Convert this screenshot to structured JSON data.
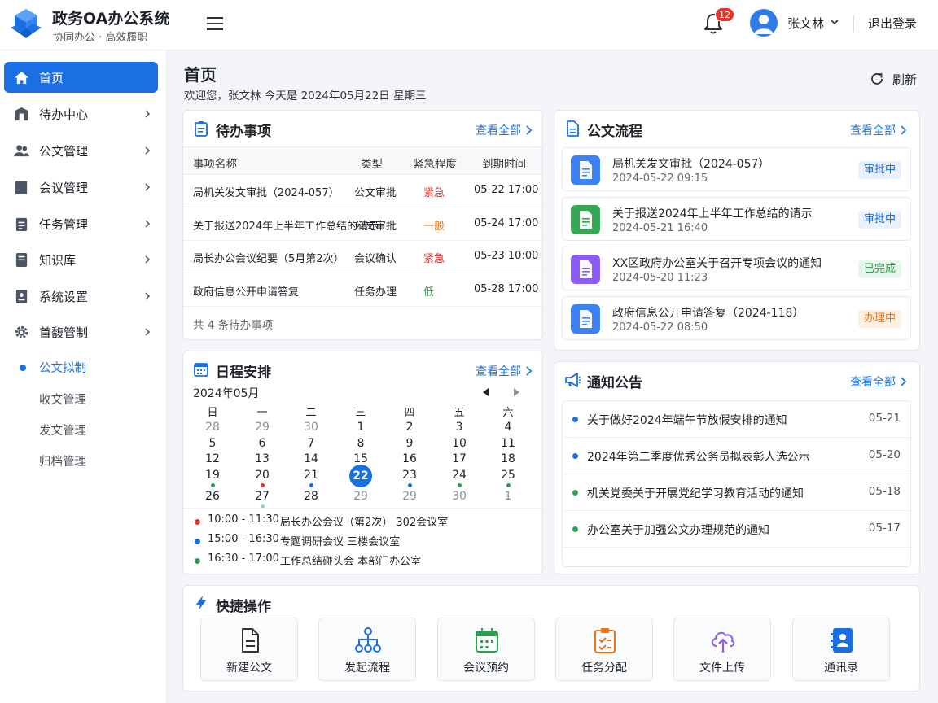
{
  "app": {
    "title": "政务OA办公系统",
    "subtitle": "协同办公 · 高效履职"
  },
  "header": {
    "notification_count": "12",
    "user_name": "张文林",
    "logout": "退出登录"
  },
  "sidebar": {
    "items": [
      {
        "label": "首页",
        "icon": "home-icon",
        "active": true
      },
      {
        "label": "待办中心",
        "icon": "inbox-icon"
      },
      {
        "label": "公文管理",
        "icon": "users-icon"
      },
      {
        "label": "会议管理",
        "icon": "meeting-icon"
      },
      {
        "label": "任务管理",
        "icon": "task-icon"
      },
      {
        "label": "知识库",
        "icon": "book-icon"
      },
      {
        "label": "系统设置",
        "icon": "settings-icon"
      },
      {
        "label": "首馥管制",
        "icon": "gear-icon"
      }
    ],
    "sub_items": [
      {
        "label": "公文拟制",
        "active": true
      },
      {
        "label": "收文管理"
      },
      {
        "label": "发文管理"
      },
      {
        "label": "归档管理"
      }
    ]
  },
  "page": {
    "title": "首页",
    "welcome": "欢迎您，张文林  今天是 2024年05月22日  星期三",
    "refresh": "刷新"
  },
  "todo": {
    "title": "待办事项",
    "more": "查看全部",
    "columns": [
      "事项名称",
      "类型",
      "紧急程度",
      "到期时间"
    ],
    "rows": [
      {
        "name": "局机关发文审批（2024-057）",
        "type": "公文审批",
        "urgency": "紧急",
        "due": "05-22 17:00",
        "urgency_color": "#e5332e"
      },
      {
        "name": "关于报送2024年上半年工作总结的请示",
        "type": "公文审批",
        "urgency": "一般",
        "due": "05-24 17:00",
        "urgency_color": "#e8741a"
      },
      {
        "name": "局长办公会议纪要（5月第2次）",
        "type": "会议确认",
        "urgency": "紧急",
        "due": "05-23 10:00",
        "urgency_color": "#e5332e"
      },
      {
        "name": "政府信息公开申请答复",
        "type": "任务办理",
        "urgency": "低",
        "due": "05-28 17:00",
        "urgency_color": "#2e9e4f"
      }
    ],
    "footer": "共 4 条待办事项"
  },
  "flow": {
    "title": "公文流程",
    "more": "查看全部",
    "items": [
      {
        "title": "局机关发文审批（2024-057）",
        "time": "2024-05-22 09:15",
        "status": "审批中",
        "icon_color": "#3b82f6",
        "status_bg": "#e8f1fd",
        "status_color": "#1a6fe3"
      },
      {
        "title": "关于报送2024年上半年工作总结的请示",
        "time": "2024-05-21 16:40",
        "status": "审批中",
        "icon_color": "#34a853",
        "status_bg": "#e8f1fd",
        "status_color": "#1a6fe3"
      },
      {
        "title": "XX区政府办公室关于召开专项会议的通知",
        "time": "2024-05-20 11:23",
        "status": "已完成",
        "icon_color": "#8b5cf6",
        "status_bg": "#e7f6ea",
        "status_color": "#2e9e4f"
      },
      {
        "title": "政府信息公开申请答复（2024-118）",
        "time": "2024-05-22 08:50",
        "status": "办理中",
        "icon_color": "#3b82f6",
        "status_bg": "#fdf0e3",
        "status_color": "#e8741a"
      }
    ]
  },
  "calendar": {
    "title": "日程安排",
    "more": "查看全部",
    "month": "2024年05月",
    "weekdays": [
      "日",
      "一",
      "二",
      "三",
      "四",
      "五",
      "六"
    ],
    "weeks": [
      [
        {
          "d": "28",
          "m": true
        },
        {
          "d": "29",
          "m": true
        },
        {
          "d": "30",
          "m": true
        },
        {
          "d": "1"
        },
        {
          "d": "2"
        },
        {
          "d": "3"
        },
        {
          "d": "4"
        }
      ],
      [
        {
          "d": "5"
        },
        {
          "d": "6"
        },
        {
          "d": "7"
        },
        {
          "d": "8"
        },
        {
          "d": "9"
        },
        {
          "d": "10"
        },
        {
          "d": "11"
        }
      ],
      [
        {
          "d": "12"
        },
        {
          "d": "13"
        },
        {
          "d": "14"
        },
        {
          "d": "15"
        },
        {
          "d": "16"
        },
        {
          "d": "17"
        },
        {
          "d": "18"
        }
      ],
      [
        {
          "d": "19",
          "dot": "#2e9e4f"
        },
        {
          "d": "20",
          "dot": "#e5332e"
        },
        {
          "d": "21",
          "dot": "#1a6fe3"
        },
        {
          "d": "22",
          "today": true
        },
        {
          "d": "23",
          "dot": "#1a6fe3"
        },
        {
          "d": "24",
          "dot": "#2e9e4f"
        },
        {
          "d": "25",
          "dot": "#2e9e4f"
        }
      ],
      [
        {
          "d": "26"
        },
        {
          "d": "27",
          "dot": "#9ad1a5"
        },
        {
          "d": "28"
        },
        {
          "d": "29",
          "m": true
        },
        {
          "d": "29",
          "m": true
        },
        {
          "d": "30",
          "m": true
        },
        {
          "d": "1",
          "m": true
        }
      ]
    ],
    "schedule": [
      {
        "time": "10:00 - 11:30",
        "desc": "局长办公会议（第2次） 302会议室",
        "color": "#e5332e"
      },
      {
        "time": "15:00 - 16:30",
        "desc": "专题调研会议  三楼会议室",
        "color": "#1a6fe3"
      },
      {
        "time": "16:30 - 17:00",
        "desc": "工作总结碰头会  本部门办公室",
        "color": "#2e9e4f"
      }
    ]
  },
  "notices": {
    "title": "通知公告",
    "more": "查看全部",
    "items": [
      {
        "text": "关于做好2024年端午节放假安排的通知",
        "date": "05-21",
        "color": "#1a6fe3"
      },
      {
        "text": "2024年第二季度优秀公务员拟表彰人选公示",
        "date": "05-20",
        "color": "#1a6fe3"
      },
      {
        "text": "机关党委关于开展党纪学习教育活动的通知",
        "date": "05-18",
        "color": "#2e9e4f"
      },
      {
        "text": "办公室关于加强公文办理规范的通知",
        "date": "05-17",
        "color": "#2e9e4f"
      }
    ]
  },
  "quick": {
    "title": "快捷操作",
    "items": [
      {
        "label": "新建公文",
        "icon": "new-document-icon"
      },
      {
        "label": "发起流程",
        "icon": "workflow-icon"
      },
      {
        "label": "会议预约",
        "icon": "calendar-icon"
      },
      {
        "label": "任务分配",
        "icon": "clipboard-check-icon"
      },
      {
        "label": "文件上传",
        "icon": "cloud-upload-icon"
      },
      {
        "label": "通讯录",
        "icon": "contacts-icon"
      }
    ]
  },
  "colors": {
    "primary": "#1a6fe3",
    "danger": "#e5332e",
    "warning": "#e8741a",
    "success": "#2e9e4f"
  }
}
